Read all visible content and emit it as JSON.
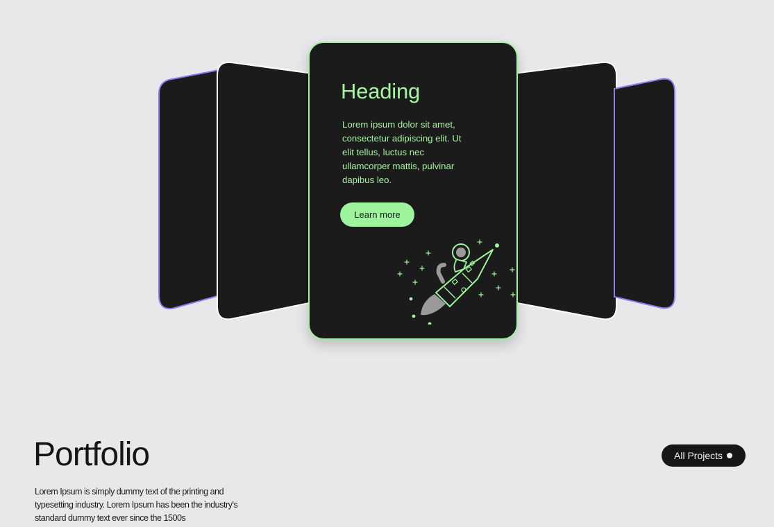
{
  "carousel": {
    "center_card": {
      "heading": "Heading",
      "body": "Lorem ipsum dolor sit amet, consectetur adipiscing elit. Ut elit tellus, luctus nec ullamcorper mattis, pulvinar dapibus leo.",
      "button_label": "Learn more",
      "illustration": "astronaut-rocket-illustration"
    },
    "colors": {
      "card_bg": "#1b1b1b",
      "center_accent": "#9cf59c",
      "outer_border": "#8b7cf0",
      "inner_border": "#ffffff"
    }
  },
  "portfolio": {
    "title": "Portfolio",
    "description": "Lorem Ipsum is simply dummy text of the printing and typesetting industry. Lorem Ipsum has been the industry's standard dummy text ever since the 1500s",
    "all_projects_label": "All Projects",
    "all_projects_icon": "dot-icon"
  }
}
